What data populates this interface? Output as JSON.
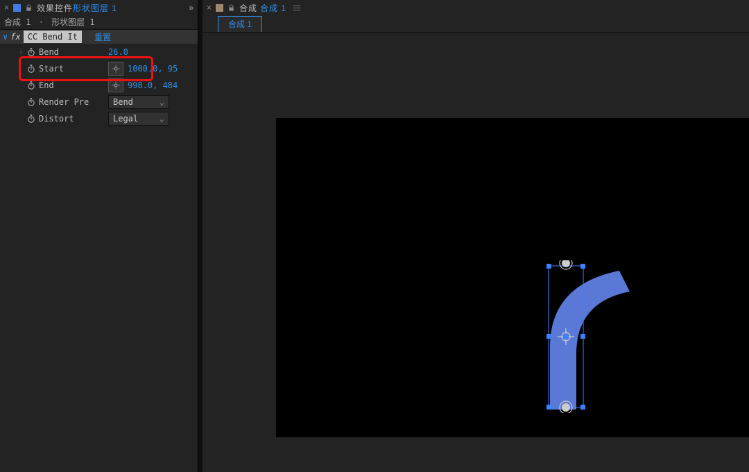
{
  "left": {
    "tab": {
      "title_prefix": "效果控件",
      "title_layer": "形状图层 1",
      "close": "×",
      "chevrons": "»"
    },
    "crumb": {
      "comp": "合成 1",
      "sep": "·",
      "layer": "形状图层 1"
    },
    "fx": {
      "twist": "∨",
      "fx_label": "fx",
      "name": "CC Bend It",
      "reset": "重置"
    },
    "props": {
      "bend": {
        "label": "Bend",
        "value": "26.0"
      },
      "start": {
        "label": "Start",
        "value": "1000.0, 95"
      },
      "end": {
        "label": "End",
        "value": "998.0, 484"
      },
      "render": {
        "label": "Render Pre",
        "value": "Bend"
      },
      "distort": {
        "label": "Distort",
        "value": "Legal"
      }
    }
  },
  "right": {
    "tab": {
      "close": "×",
      "title_prefix": "合成",
      "title_comp": "合成 1"
    },
    "subtab": "合成 1"
  }
}
